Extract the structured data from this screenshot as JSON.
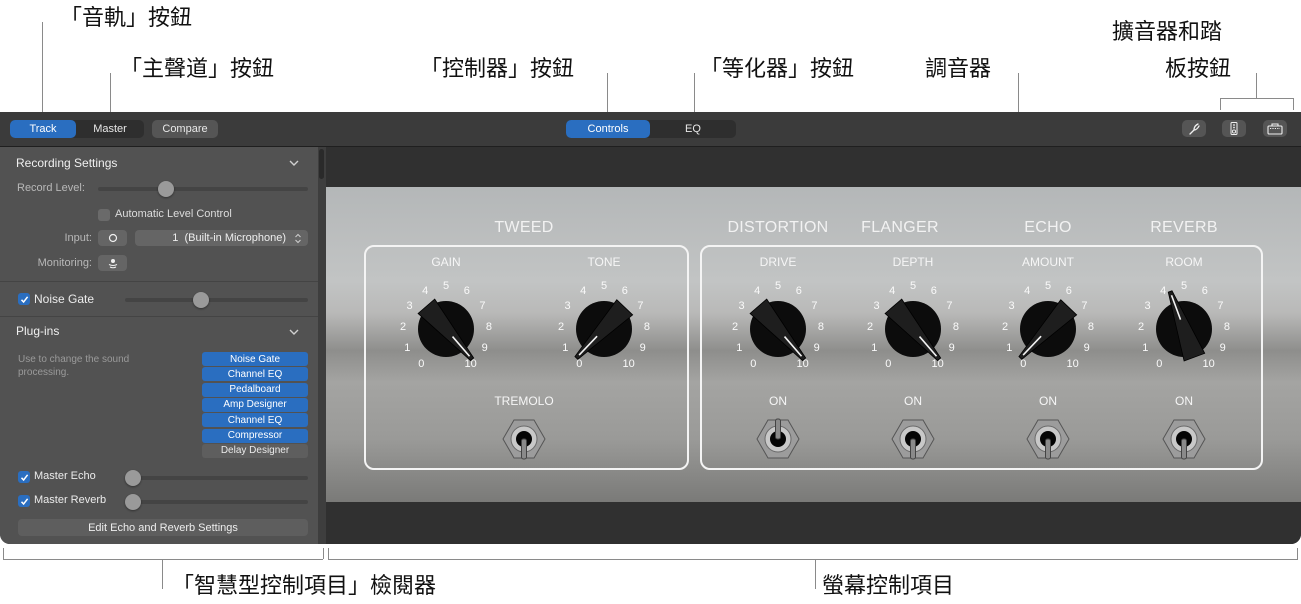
{
  "callouts": {
    "track": "「音軌」按鈕",
    "master": "「主聲道」按鈕",
    "controls": "「控制器」按鈕",
    "eq": "「等化器」按鈕",
    "tuner": "調音器",
    "amp_pedal_line1": "擴音器和踏",
    "amp_pedal_line2": "板按鈕",
    "inspector": "「智慧型控制項目」檢閱器",
    "screen_controls": "螢幕控制項目"
  },
  "toolbar": {
    "track": "Track",
    "master": "Master",
    "compare": "Compare",
    "controls": "Controls",
    "eq": "EQ",
    "active_left": "Track",
    "active_center": "Controls",
    "icons": [
      "tuner-icon",
      "pedalboard-icon",
      "amp-icon"
    ]
  },
  "sidebar": {
    "recording": {
      "title": "Recording Settings",
      "record_level_label": "Record Level:",
      "record_level_value": 0.31,
      "auto_level_label": "Automatic Level Control",
      "auto_level_checked": false,
      "input_label": "Input:",
      "input_value": "1  (Built-in Microphone)",
      "monitoring_label": "Monitoring:"
    },
    "noise_gate": {
      "label": "Noise Gate",
      "checked": true,
      "value": 0.41
    },
    "plugins": {
      "title": "Plug-ins",
      "description": "Use to change the sound processing.",
      "items": [
        {
          "label": "Noise Gate",
          "active": true
        },
        {
          "label": "Channel EQ",
          "active": true
        },
        {
          "label": "Pedalboard",
          "active": true
        },
        {
          "label": "Amp Designer",
          "active": true
        },
        {
          "label": "Channel EQ",
          "active": true
        },
        {
          "label": "Compressor",
          "active": true
        },
        {
          "label": "Delay Designer",
          "active": false
        }
      ]
    },
    "master_echo": {
      "label": "Master Echo",
      "checked": true,
      "value": 0
    },
    "master_reverb": {
      "label": "Master Reverb",
      "checked": true,
      "value": 0
    },
    "edit_button": "Edit Echo and Reverb Settings"
  },
  "amp": {
    "sections": [
      "TWEED",
      "DISTORTION",
      "FLANGER",
      "ECHO",
      "REVERB"
    ],
    "knobs": [
      {
        "section": "TWEED",
        "label": "GAIN",
        "value": 9.8
      },
      {
        "section": "TWEED",
        "label": "TONE",
        "value": 0.3
      },
      {
        "section": "DISTORTION",
        "label": "DRIVE",
        "value": 9.8
      },
      {
        "section": "FLANGER",
        "label": "DEPTH",
        "value": 9.8
      },
      {
        "section": "ECHO",
        "label": "AMOUNT",
        "value": 0.3
      },
      {
        "section": "REVERB",
        "label": "ROOM",
        "value": 4.3
      }
    ],
    "scale": [
      "0",
      "1",
      "2",
      "3",
      "4",
      "5",
      "6",
      "7",
      "8",
      "9",
      "10"
    ],
    "switches": [
      {
        "label": "TREMOLO",
        "state": "down"
      },
      {
        "label": "ON",
        "state": "up"
      },
      {
        "label": "ON",
        "state": "down"
      },
      {
        "label": "ON",
        "state": "down"
      },
      {
        "label": "ON",
        "state": "down"
      }
    ]
  }
}
